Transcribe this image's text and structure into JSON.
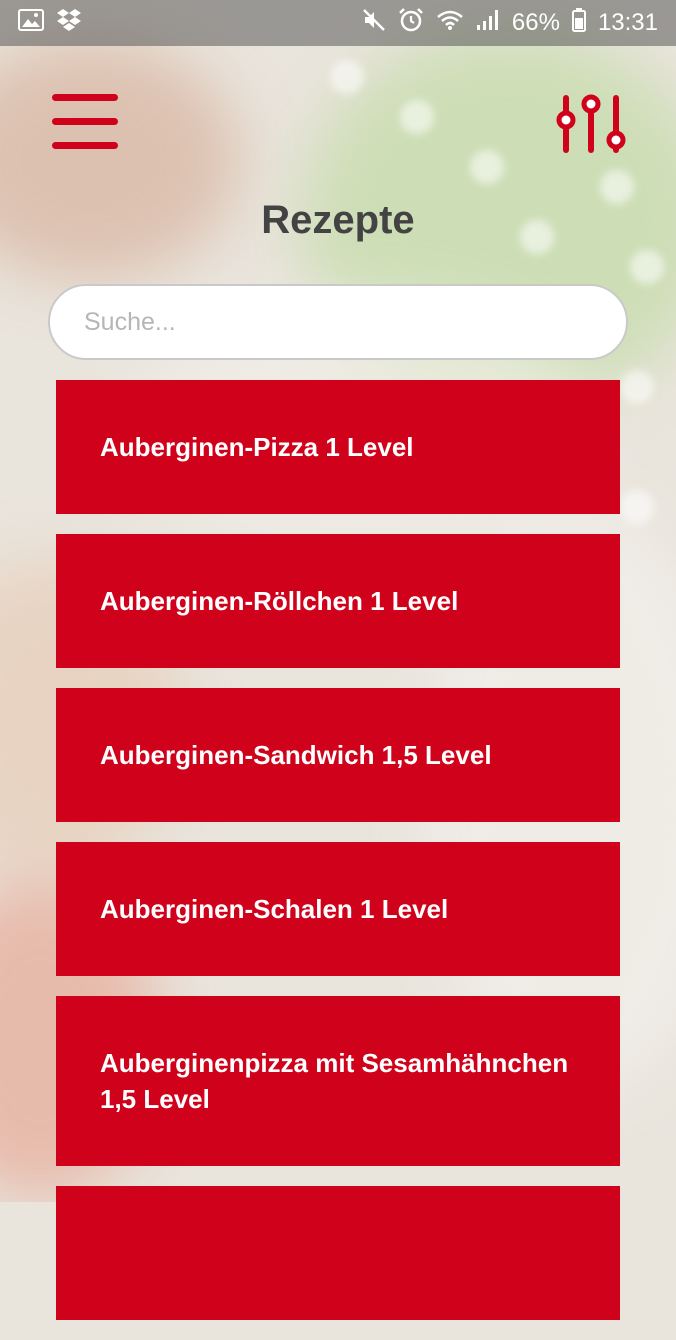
{
  "status_bar": {
    "left_icons": [
      "image-icon",
      "dropbox-icon"
    ],
    "right_icons": [
      "mute-icon",
      "alarm-icon",
      "wifi-icon",
      "signal-icon"
    ],
    "battery": "66%",
    "time": "13:31"
  },
  "header": {
    "title": "Rezepte",
    "menu_icon": "hamburger-menu-icon",
    "filter_icon": "sliders-filter-icon"
  },
  "search": {
    "placeholder": "Suche...",
    "value": ""
  },
  "recipes": [
    {
      "label": "Auberginen-Pizza 1 Level"
    },
    {
      "label": "Auberginen-Röllchen 1 Level"
    },
    {
      "label": "Auberginen-Sandwich 1,5 Level"
    },
    {
      "label": "Auberginen-Schalen 1 Level"
    },
    {
      "label": "Auberginenpizza mit Sesamhähnchen 1,5 Level"
    },
    {
      "label": ""
    }
  ],
  "colors": {
    "accent": "#d0021b",
    "title": "#434343"
  }
}
